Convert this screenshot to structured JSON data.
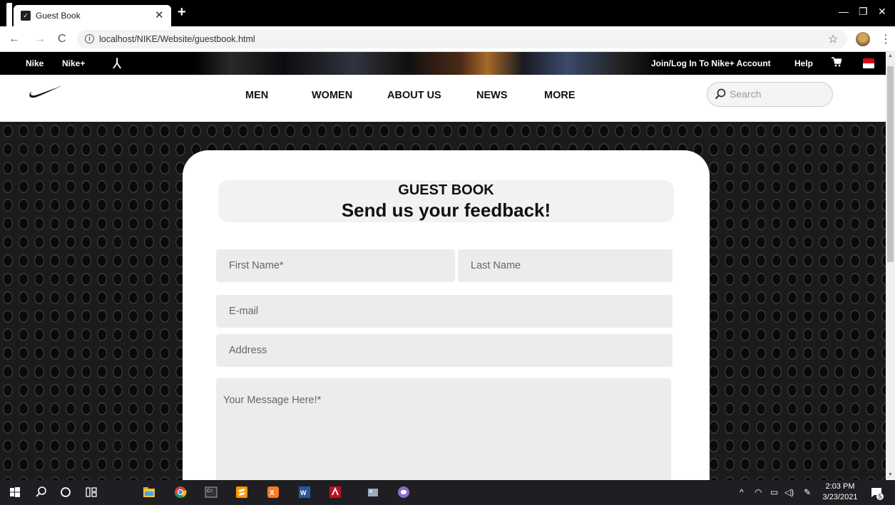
{
  "browser": {
    "tab_title": "Guest Book",
    "url": "localhost/NIKE/Website/guestbook.html"
  },
  "topbar": {
    "links": [
      "Nike",
      "Nike+"
    ],
    "account_link": "Join/Log In To Nike+ Account",
    "help_link": "Help"
  },
  "header": {
    "menu": [
      "MEN",
      "WOMEN",
      "ABOUT US",
      "NEWS",
      "MORE"
    ],
    "search_placeholder": "Search"
  },
  "form": {
    "heading_small": "GUEST BOOK",
    "heading_big": "Send us your feedback!",
    "first_name_placeholder": "First Name*",
    "last_name_placeholder": "Last Name",
    "email_placeholder": "E-mail",
    "address_placeholder": "Address",
    "message_placeholder": "Your Message Here!*"
  },
  "taskbar": {
    "time": "2:03 PM",
    "date": "3/23/2021",
    "notification_count": "5"
  },
  "colors": {
    "flag_red": "#e0001a",
    "field_bg": "#ececec",
    "page_bg": "#151515"
  }
}
